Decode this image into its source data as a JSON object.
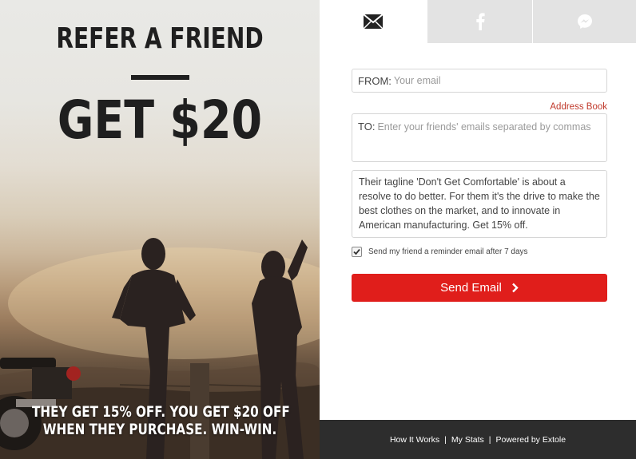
{
  "promo": {
    "title": "REFER A FRIEND",
    "amount": "GET $20",
    "bottom_line1": "THEY GET 15% OFF. YOU GET $20 OFF",
    "bottom_line2": "WHEN THEY PURCHASE. WIN-WIN."
  },
  "tabs": [
    {
      "name": "email",
      "icon": "envelope-icon",
      "active": true
    },
    {
      "name": "facebook",
      "icon": "facebook-icon",
      "active": false
    },
    {
      "name": "messenger",
      "icon": "messenger-icon",
      "active": false
    }
  ],
  "form": {
    "from_label": "FROM:",
    "from_placeholder": "Your email",
    "address_book": "Address Book",
    "to_label": "TO:",
    "to_placeholder": "Enter your friends' emails separated by commas",
    "message": "Their tagline 'Don't Get Comfortable' is about a resolve to do better. For them it's the drive to make the best clothes on the market, and to innovate in American manufacturing. Get 15% off.",
    "reminder_label": "Send my friend a reminder email after 7 days",
    "reminder_checked": true,
    "send_label": "Send Email"
  },
  "footer": {
    "how_it_works": "How It Works",
    "my_stats": "My Stats",
    "powered_by": "Powered by Extole",
    "separator": "|"
  },
  "colors": {
    "accent": "#e01e1b",
    "link": "#c0392b",
    "footer_bg": "#2d2d2d",
    "tab_inactive": "#e3e3e3"
  }
}
